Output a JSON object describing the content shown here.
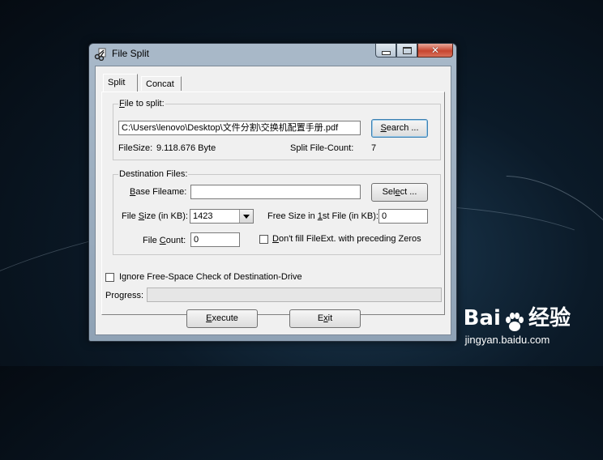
{
  "window": {
    "title": "File Split",
    "caption": {
      "close_glyph": "✕"
    }
  },
  "tabs": [
    {
      "label": "Split",
      "active": true
    },
    {
      "label": "Concat",
      "active": false
    }
  ],
  "file_to_split": {
    "group_label_ul": "F",
    "group_label_rest": "ile to split:",
    "path_value": "C:\\Users\\lenovo\\Desktop\\文件分割\\交换机配置手册.pdf",
    "search_button_ul": "S",
    "search_button_rest": "earch ...",
    "filesize_label": "FileSize:",
    "filesize_value": "9.118.676 Byte",
    "split_count_label": "Split File-Count:",
    "split_count_value": "7"
  },
  "destination": {
    "group_label": "Destination Files:",
    "base_label_ul": "B",
    "base_label_rest": "ase Fileame:",
    "base_value": "",
    "select_button_pre": "Sel",
    "select_button_ul": "e",
    "select_button_post": "ct ...",
    "filesize_label_pre": "File ",
    "filesize_label_ul": "S",
    "filesize_label_post": "ize (in KB):",
    "filesize_value": "1423",
    "free_label_pre": "Free Size in ",
    "free_label_ul": "1",
    "free_label_post": "st File (in KB):",
    "free_value": "0",
    "count_label_pre": "File ",
    "count_label_ul": "C",
    "count_label_post": "ount:",
    "count_value": "0",
    "zeros_label_ul": "D",
    "zeros_label_rest": "on't fill FileExt. with preceding Zeros",
    "zeros_checked": false
  },
  "ignore_check": {
    "label": "Ignore Free-Space Check of Destination-Drive",
    "checked": false
  },
  "progress": {
    "label": "Progress:",
    "value": 0
  },
  "buttons": {
    "execute_ul": "E",
    "execute_rest": "xecute",
    "exit_pre": "E",
    "exit_ul": "x",
    "exit_post": "it"
  },
  "watermark": {
    "logo_left": "Bai",
    "logo_right": "经验",
    "url": "jingyan.baidu.com"
  }
}
